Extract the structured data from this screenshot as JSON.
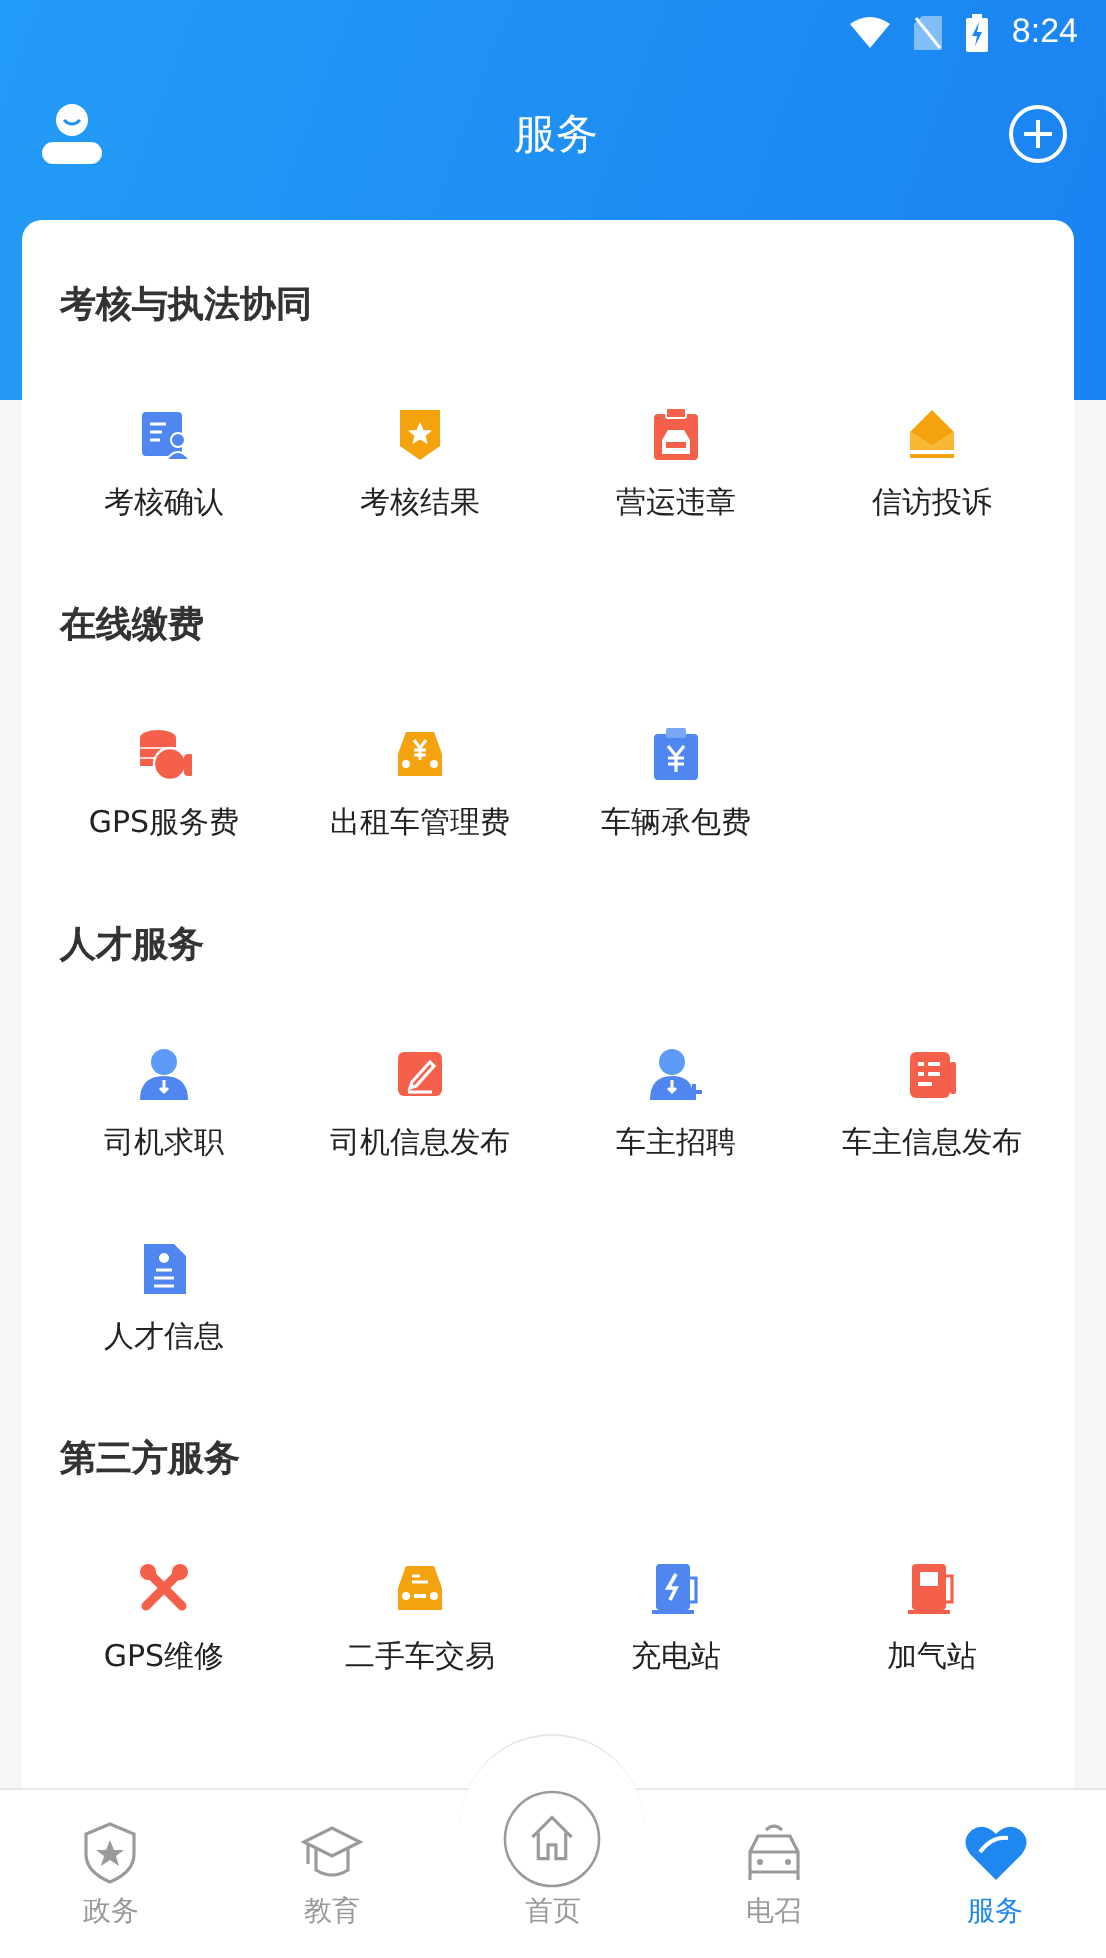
{
  "status_bar": {
    "time": "8:24"
  },
  "header": {
    "title": "服务"
  },
  "sections": [
    {
      "title": "考核与执法协同",
      "items": [
        "考核确认",
        "考核结果",
        "营运违章",
        "信访投诉"
      ]
    },
    {
      "title": "在线缴费",
      "items": [
        "GPS服务费",
        "出租车管理费",
        "车辆承包费"
      ]
    },
    {
      "title": "人才服务",
      "items": [
        "司机求职",
        "司机信息发布",
        "车主招聘",
        "车主信息发布",
        "人才信息"
      ]
    },
    {
      "title": "第三方服务",
      "items": [
        "GPS维修",
        "二手车交易",
        "充电站",
        "加气站"
      ]
    }
  ],
  "tab_bar": [
    {
      "label": "政务",
      "selected": false
    },
    {
      "label": "教育",
      "selected": false
    },
    {
      "label": "首页",
      "selected": false
    },
    {
      "label": "电召",
      "selected": false
    },
    {
      "label": "服务",
      "selected": true
    }
  ]
}
